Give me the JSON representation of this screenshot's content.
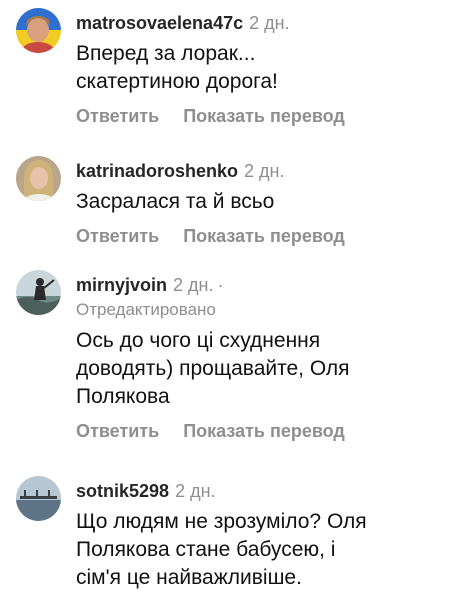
{
  "comments": [
    {
      "username": "matrosovaelena47c",
      "time": "2 дн.",
      "text_lines": [
        "Вперед за лорак...",
        "скатертиною дорога!"
      ],
      "reply_label": "Ответить",
      "translate_label": "Показать перевод",
      "avatar": "avatar-woman-ukraine-flag"
    },
    {
      "username": "katrinadoroshenko",
      "time": "2 дн.",
      "text_lines": [
        "Засралася та й всьо"
      ],
      "reply_label": "Ответить",
      "translate_label": "Показать перевод",
      "avatar": "avatar-woman-blonde"
    },
    {
      "username": "mirnyjvoin",
      "time": "2 дн.",
      "separator": "·",
      "edited_label": "Отредактировано",
      "text_lines": [
        "Ось до чого ці схуднення",
        "доводять) прощавайте, Оля",
        "Полякова"
      ],
      "reply_label": "Ответить",
      "translate_label": "Показать перевод",
      "avatar": "avatar-person-landscape"
    },
    {
      "username": "sotnik5298",
      "time": "2 дн.",
      "text_lines": [
        "Що людям не зрозуміло? Оля",
        "Полякова стане бабусею, і",
        "сім'я це найважливіше."
      ],
      "avatar": "avatar-pier-sea"
    }
  ],
  "colors": {
    "username": "#262626",
    "secondary": "#8e8e8e",
    "text": "#111111"
  }
}
